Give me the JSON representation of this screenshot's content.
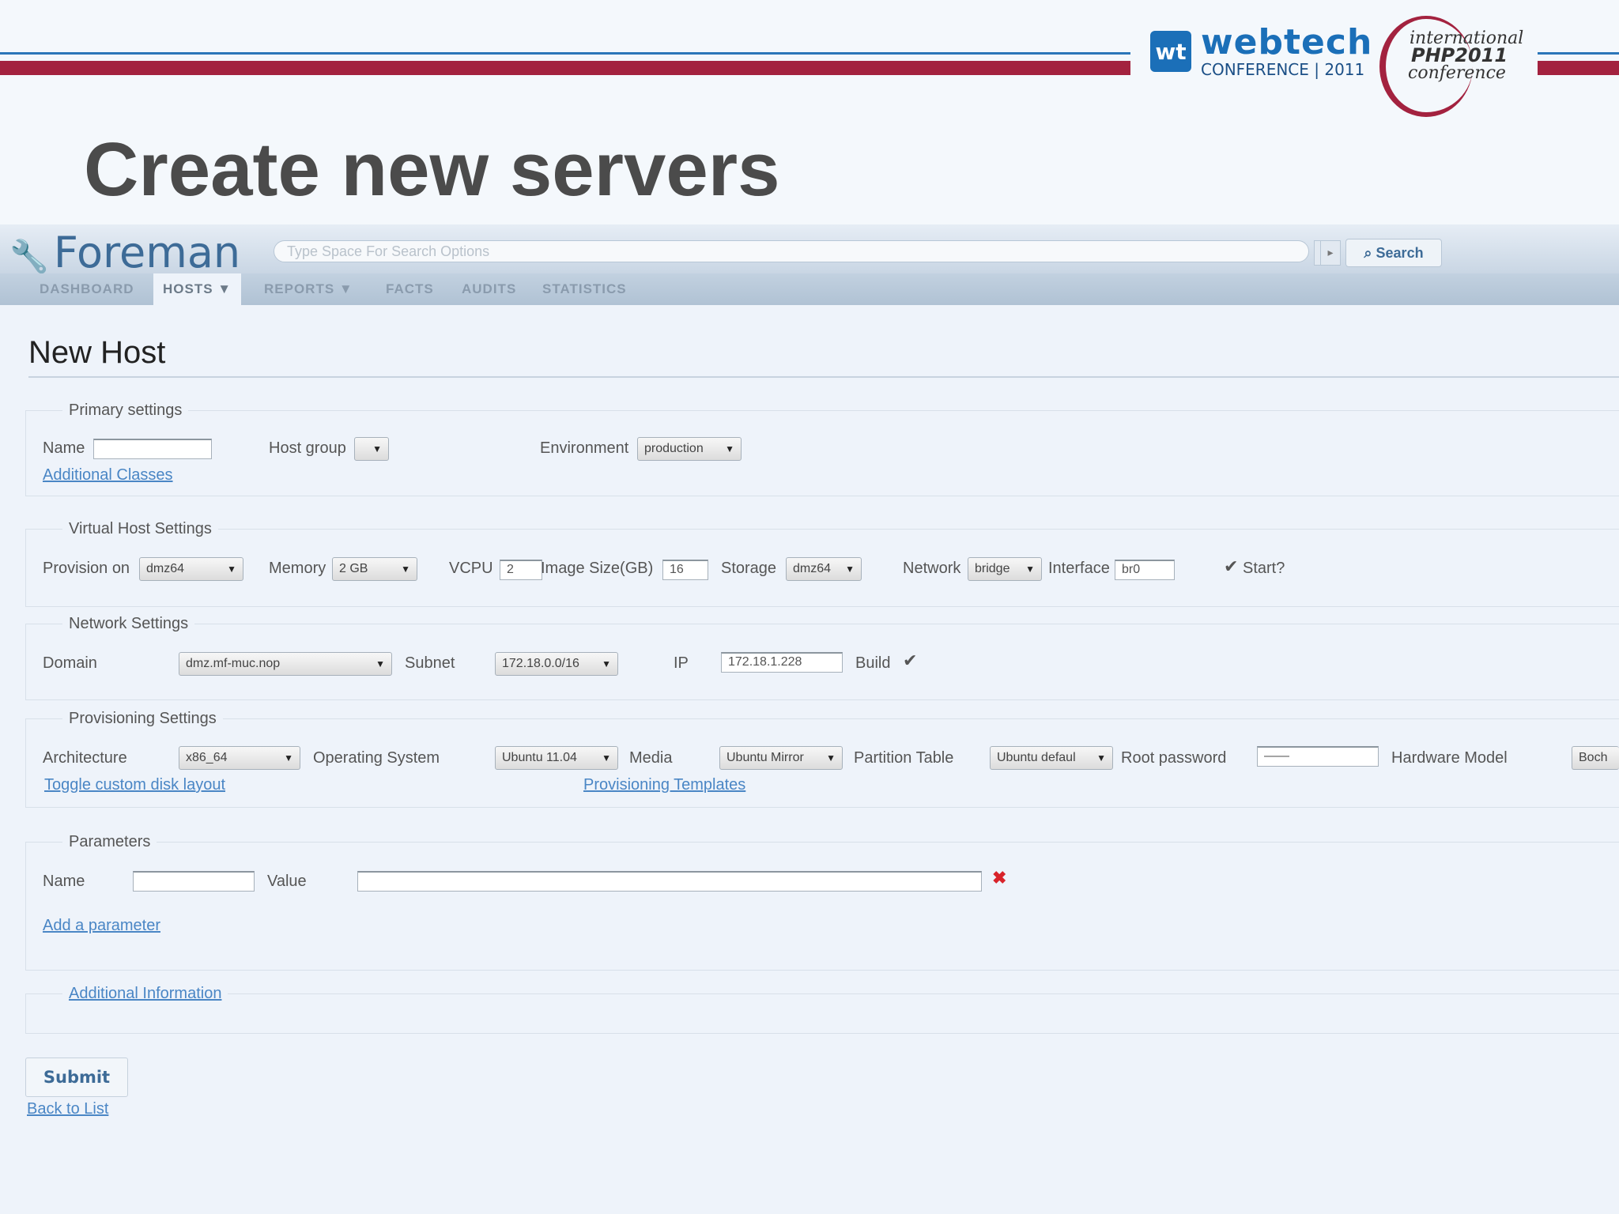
{
  "slide": {
    "title": "Create new servers",
    "logo_webtech": {
      "mark": "wt",
      "name": "webtech",
      "subtitle": "CONFERENCE | 2011"
    },
    "logo_php": {
      "line1": "international",
      "line2": "PHP2011",
      "line3": "conference"
    },
    "colors": {
      "accent_red": "#a3223f",
      "accent_blue": "#2b76b9"
    }
  },
  "app": {
    "brand": "Foreman",
    "brand_icon": "wrench-icon",
    "search": {
      "placeholder": "Type Space For Search Options",
      "button": "Search"
    },
    "nav": [
      "DASHBOARD",
      "HOSTS ▼",
      "REPORTS ▼",
      "FACTS",
      "AUDITS",
      "STATISTICS"
    ],
    "active_tab": "HOSTS ▼"
  },
  "form": {
    "title": "New Host",
    "primary": {
      "legend": "Primary settings",
      "name_label": "Name",
      "name_value": "",
      "hostgroup_label": "Host group",
      "hostgroup_value": "",
      "environment_label": "Environment",
      "environment_value": "production",
      "additional_classes": "Additional Classes"
    },
    "virtual": {
      "legend": "Virtual Host Settings",
      "provision_label": "Provision on",
      "provision_value": "dmz64",
      "memory_label": "Memory",
      "memory_value": "2 GB",
      "vcpu_label": "VCPU",
      "vcpu_value": "2",
      "image_label": "Image Size(GB)",
      "image_value": "16",
      "storage_label": "Storage",
      "storage_value": "dmz64",
      "network_label": "Network",
      "network_value": "bridge",
      "interface_label": "Interface",
      "interface_value": "br0",
      "start_label": "Start?",
      "start_checked": true
    },
    "network": {
      "legend": "Network Settings",
      "domain_label": "Domain",
      "domain_value": "dmz.mf-muc.nop",
      "subnet_label": "Subnet",
      "subnet_value": "172.18.0.0/16",
      "ip_label": "IP",
      "ip_value": "172.18.1.228",
      "build_label": "Build",
      "build_checked": true
    },
    "provisioning": {
      "legend": "Provisioning Settings",
      "arch_label": "Architecture",
      "arch_value": "x86_64",
      "os_label": "Operating System",
      "os_value": "Ubuntu 11.04",
      "media_label": "Media",
      "media_value": "Ubuntu Mirror",
      "ptable_label": "Partition Table",
      "ptable_value": "Ubuntu defaul",
      "rootpw_label": "Root password",
      "rootpw_value": "——",
      "hwmodel_label": "Hardware Model",
      "hwmodel_value": "Boch",
      "toggle_disk": "Toggle custom disk layout",
      "templates": "Provisioning Templates"
    },
    "parameters": {
      "legend": "Parameters",
      "name_label": "Name",
      "value_label": "Value",
      "delete_icon": "x-icon",
      "add": "Add a parameter"
    },
    "additional_info": "Additional Information",
    "submit": "Submit",
    "back": "Back to List"
  }
}
